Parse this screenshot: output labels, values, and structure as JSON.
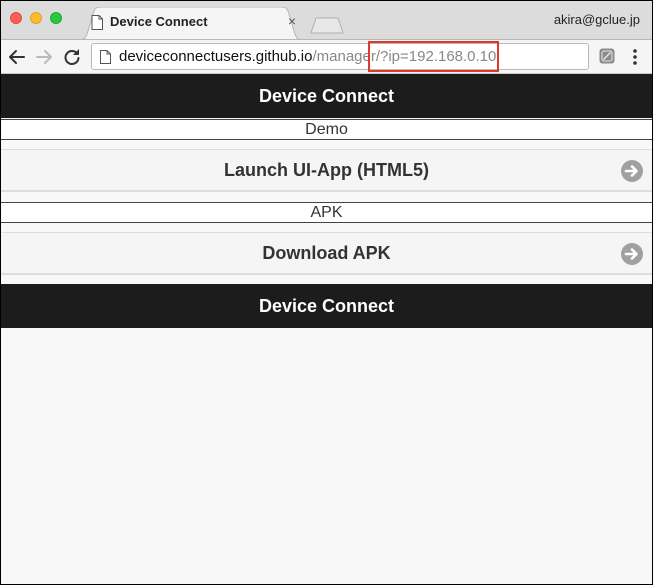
{
  "browser": {
    "tab_title": "Device Connect",
    "tab_close_glyph": "×",
    "profile_name": "akira@gclue.jp",
    "url_host": "deviceconnectusers.github.io",
    "url_path": "/manager/?ip=192.168.0.10",
    "icons": {
      "back": "arrow-left",
      "forward": "arrow-right",
      "reload": "reload",
      "page": "document",
      "extension": "extension",
      "menu": "vertical-dots"
    },
    "annotation_color": "#e0392c"
  },
  "page": {
    "header_title": "Device Connect",
    "footer_title": "Device Connect",
    "sections": [
      {
        "label": "Demo",
        "button_label": "Launch UI-App (HTML5)"
      },
      {
        "label": "APK",
        "button_label": "Download APK"
      }
    ],
    "colors": {
      "header_bg": "#1c1c1c",
      "button_bg": "#f5f5f5",
      "arrow_icon": "#a0a0a0"
    }
  }
}
